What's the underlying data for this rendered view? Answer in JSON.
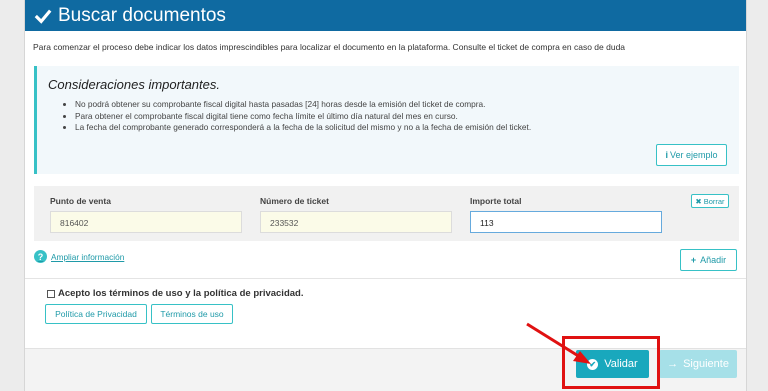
{
  "header": {
    "title": "Buscar documentos"
  },
  "intro": "Para comenzar el proceso debe indicar los datos imprescindibles para localizar el documento en la plataforma. Consulte el ticket de compra en caso de duda",
  "considerations": {
    "title": "Consideraciones importantes.",
    "items": [
      "No podrá obtener su comprobante fiscal digital hasta pasadas [24] horas desde la emisión del ticket de compra.",
      "Para obtener el comprobante fiscal digital tiene como fecha límite el último día natural del mes en curso.",
      "La fecha del comprobante generado corresponderá a la fecha de la solicitud del mismo y no a la fecha de emisión del ticket."
    ],
    "example_button": "Ver ejemplo"
  },
  "fields": {
    "punto_de_venta": {
      "label": "Punto de venta",
      "value": "816402"
    },
    "numero_ticket": {
      "label": "Número de ticket",
      "value": "233532"
    },
    "importe_total": {
      "label": "Importe total",
      "value": "113"
    },
    "borrar_label": "Borrar"
  },
  "ampliar_label": "Ampliar información",
  "anadir_label": "Añadir",
  "terms": {
    "label": "Acepto los términos de uso y la política de privacidad.",
    "privacy_button": "Política de Privacidad",
    "terms_button": "Términos de uso"
  },
  "footer": {
    "validar_label": "Validar",
    "siguiente_label": "Siguiente"
  },
  "colors": {
    "header": "#0f6aa1",
    "accent": "#37c1c6",
    "annotation": "#e01111"
  }
}
